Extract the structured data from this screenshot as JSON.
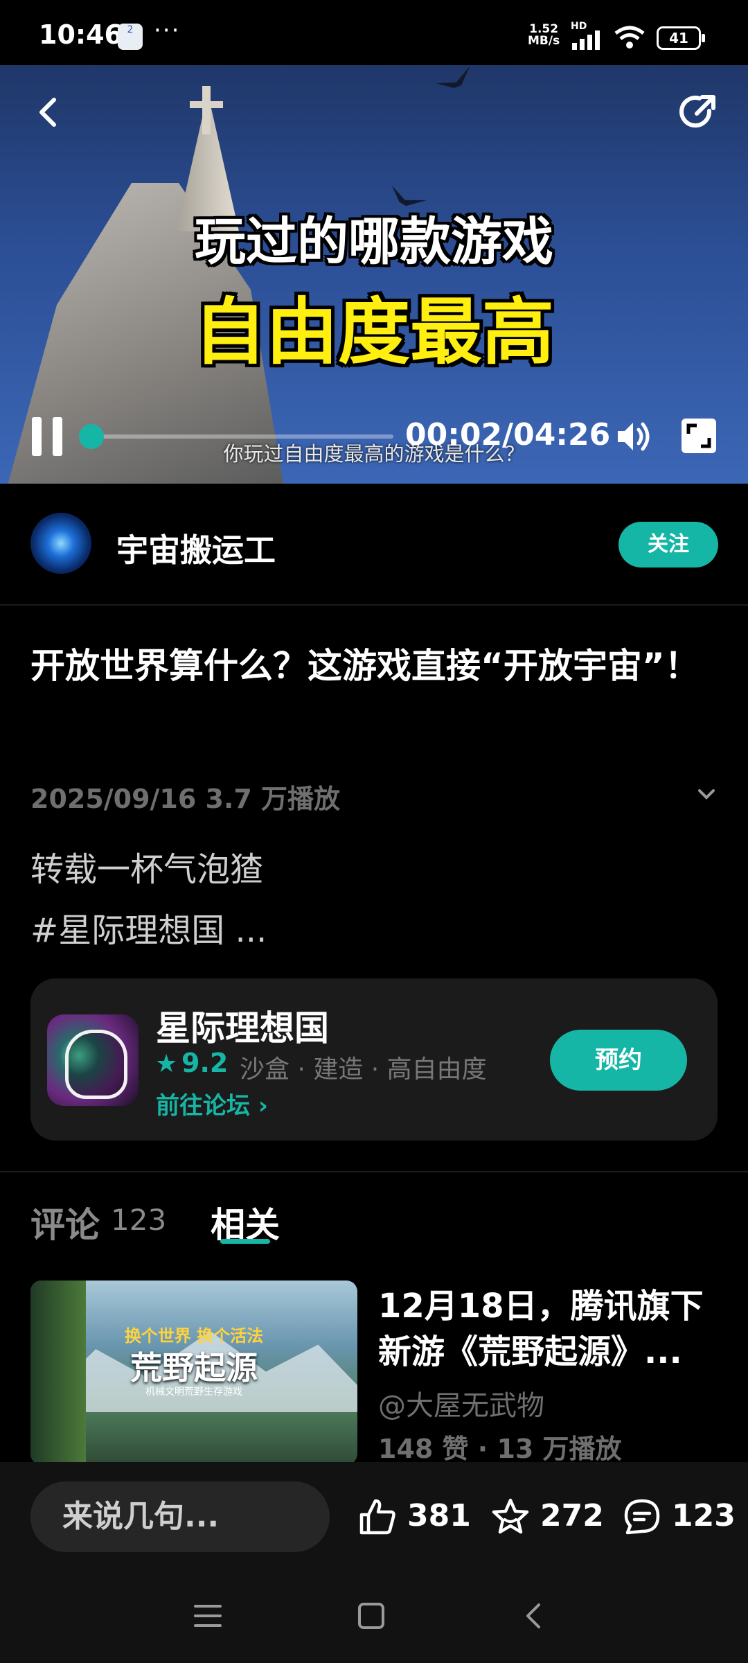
{
  "status_bar": {
    "time": "10:46",
    "notification_badge": "2",
    "more": "···",
    "net_speed_top": "1.52",
    "net_speed_bottom": "MB/s",
    "network": "HD",
    "battery": "41"
  },
  "video": {
    "headline_line1": "玩过的哪款游戏",
    "headline_line2": "自由度最高",
    "subtitle": "你玩过自由度最高的游戏是什么？",
    "time": "00:02/04:26",
    "progress": 0.008,
    "headline2_color": "#ffef10"
  },
  "author": {
    "name": "宇宙搬运工",
    "follow_label": "关注"
  },
  "post": {
    "title": "开放世界算什么？这游戏直接“开放宇宙”！",
    "meta": "2025/09/16  3.7 万播放",
    "desc_line1": "转载一杯气泡猹",
    "desc_line2": "#星际理想国 ..."
  },
  "game": {
    "name": "星际理想国",
    "rating": "9.2",
    "tags": "沙盒 · 建造 · 高自由度",
    "forum_link": "前往论坛 ›",
    "reserve_label": "预约",
    "accent": "#16b6a6"
  },
  "tabs": {
    "comments_label": "评论",
    "comments_count": "123",
    "related_label": "相关"
  },
  "related": {
    "thumb_caption1": "换个世界 换个活法",
    "thumb_caption2": "荒野起源",
    "thumb_caption3": "机械文明荒野生存游戏",
    "title": "12月18日，腾讯旗下新游《荒野起源》...",
    "author": "@大屋无武物",
    "stats": "148 赞 · 13 万播放"
  },
  "actions": {
    "comment_placeholder": "来说几句...",
    "likes": "381",
    "favorites": "272",
    "comments": "123"
  }
}
